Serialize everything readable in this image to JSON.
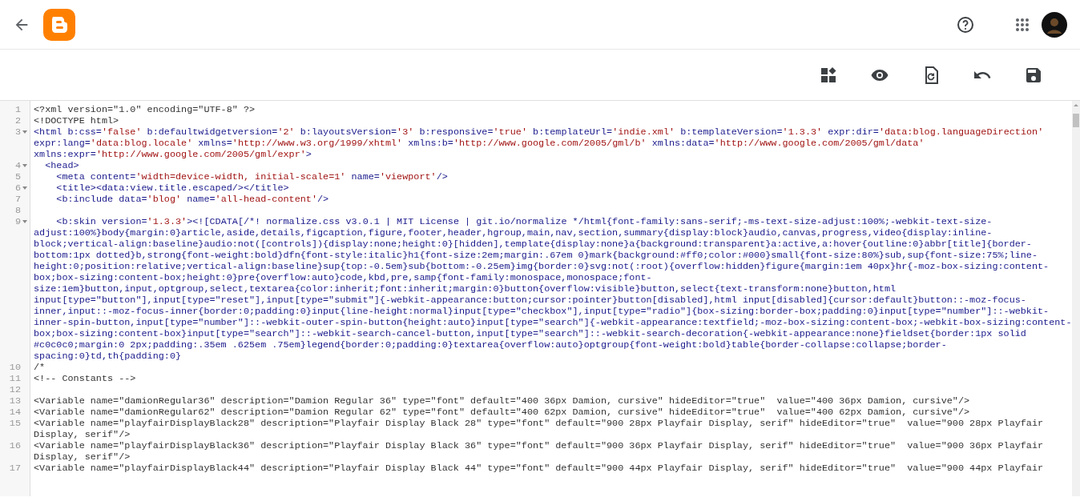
{
  "editor": {
    "lines": [
      {
        "number": "1",
        "kind": "plain",
        "foldable": false,
        "text": "<?xml version=\"1.0\" encoding=\"UTF-8\" ?>"
      },
      {
        "number": "2",
        "kind": "plain",
        "foldable": false,
        "text": "<!DOCTYPE html>"
      },
      {
        "number": "3",
        "kind": "markup",
        "foldable": true,
        "text": "<html b:css='false' b:defaultwidgetversion='2' b:layoutsVersion='3' b:responsive='true' b:templateUrl='indie.xml' b:templateVersion='1.3.3' expr:dir='data:blog.languageDirection' expr:lang='data:blog.locale' xmlns='http://www.w3.org/1999/xhtml' xmlns:b='http://www.google.com/2005/gml/b' xmlns:data='http://www.google.com/2005/gml/data' xmlns:expr='http://www.google.com/2005/gml/expr'>"
      },
      {
        "number": "4",
        "kind": "markup",
        "foldable": true,
        "text": "  <head>"
      },
      {
        "number": "5",
        "kind": "markup",
        "foldable": false,
        "text": "    <meta content='width=device-width, initial-scale=1' name='viewport'/>"
      },
      {
        "number": "6",
        "kind": "markup",
        "foldable": true,
        "text": "    <title><data:view.title.escaped/></title>"
      },
      {
        "number": "7",
        "kind": "markup",
        "foldable": false,
        "text": "    <b:include data='blog' name='all-head-content'/>"
      },
      {
        "number": "8",
        "kind": "plain",
        "foldable": false
      },
      {
        "number": "9",
        "kind": "markup",
        "foldable": true,
        "text": "    <b:skin version='1.3.3'><![CDATA[/*! normalize.css v3.0.1 | MIT License | git.io/normalize */html{font-family:sans-serif;-ms-text-size-adjust:100%;-webkit-text-size-adjust:100%}body{margin:0}article,aside,details,figcaption,figure,footer,header,hgroup,main,nav,section,summary{display:block}audio,canvas,progress,video{display:inline-block;vertical-align:baseline}audio:not([controls]){display:none;height:0}[hidden],template{display:none}a{background:transparent}a:active,a:hover{outline:0}abbr[title]{border-bottom:1px dotted}b,strong{font-weight:bold}dfn{font-style:italic}h1{font-size:2em;margin:.67em 0}mark{background:#ff0;color:#000}small{font-size:80%}sub,sup{font-size:75%;line-height:0;position:relative;vertical-align:baseline}sup{top:-0.5em}sub{bottom:-0.25em}img{border:0}svg:not(:root){overflow:hidden}figure{margin:1em 40px}hr{-moz-box-sizing:content-box;box-sizing:content-box;height:0}pre{overflow:auto}code,kbd,pre,samp{font-family:monospace,monospace;font-size:1em}button,input,optgroup,select,textarea{color:inherit;font:inherit;margin:0}button{overflow:visible}button,select{text-transform:none}button,html input[type=\"button\"],input[type=\"reset\"],input[type=\"submit\"]{-webkit-appearance:button;cursor:pointer}button[disabled],html input[disabled]{cursor:default}button::-moz-focus-inner,input::-moz-focus-inner{border:0;padding:0}input{line-height:normal}input[type=\"checkbox\"],input[type=\"radio\"]{box-sizing:border-box;padding:0}input[type=\"number\"]::-webkit-inner-spin-button,input[type=\"number\"]::-webkit-outer-spin-button{height:auto}input[type=\"search\"]{-webkit-appearance:textfield;-moz-box-sizing:content-box;-webkit-box-sizing:content-box;box-sizing:content-box}input[type=\"search\"]::-webkit-search-cancel-button,input[type=\"search\"]::-webkit-search-decoration{-webkit-appearance:none}fieldset{border:1px solid #c0c0c0;margin:0 2px;padding:.35em .625em .75em}legend{border:0;padding:0}textarea{overflow:auto}optgroup{font-weight:bold}table{border-collapse:collapse;border-spacing:0}td,th{padding:0}"
      },
      {
        "number": "10",
        "kind": "plain",
        "foldable": false,
        "text": "/*"
      },
      {
        "number": "11",
        "kind": "plain",
        "foldable": false,
        "text": "<!-- Constants -->"
      },
      {
        "number": "12",
        "kind": "plain",
        "foldable": false
      },
      {
        "number": "13",
        "kind": "plain",
        "foldable": false,
        "text": "<Variable name=\"damionRegular36\" description=\"Damion Regular 36\" type=\"font\" default=\"400 36px Damion, cursive\" hideEditor=\"true\"  value=\"400 36px Damion, cursive\"/>"
      },
      {
        "number": "14",
        "kind": "plain",
        "foldable": false,
        "text": "<Variable name=\"damionRegular62\" description=\"Damion Regular 62\" type=\"font\" default=\"400 62px Damion, cursive\" hideEditor=\"true\"  value=\"400 62px Damion, cursive\"/>"
      },
      {
        "number": "15",
        "kind": "plain",
        "foldable": false,
        "text": "<Variable name=\"playfairDisplayBlack28\" description=\"Playfair Display Black 28\" type=\"font\" default=\"900 28px Playfair Display, serif\" hideEditor=\"true\"  value=\"900 28px Playfair Display, serif\"/>"
      },
      {
        "number": "16",
        "kind": "plain",
        "foldable": false,
        "text": "<Variable name=\"playfairDisplayBlack36\" description=\"Playfair Display Black 36\" type=\"font\" default=\"900 36px Playfair Display, serif\" hideEditor=\"true\"  value=\"900 36px Playfair Display, serif\"/>"
      },
      {
        "number": "17",
        "kind": "plain",
        "foldable": false,
        "text": "<Variable name=\"playfairDisplayBlack44\" description=\"Playfair Display Black 44\" type=\"font\" default=\"900 44px Playfair Display, serif\" hideEditor=\"true\"  value=\"900 44px Playfair"
      }
    ]
  }
}
